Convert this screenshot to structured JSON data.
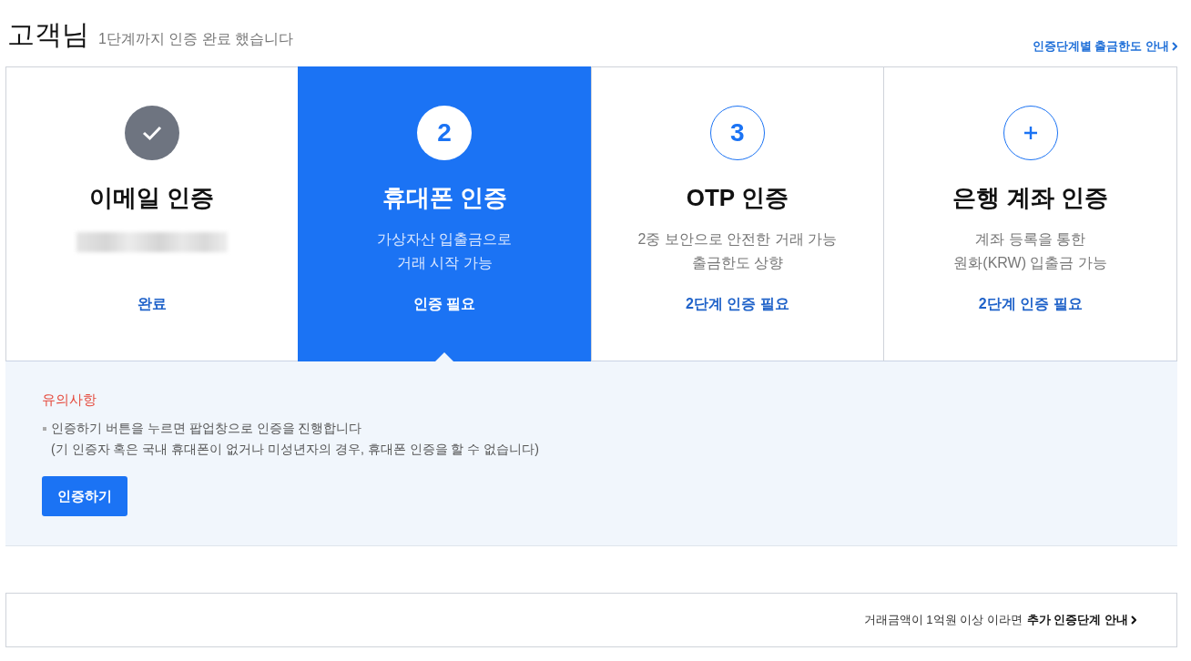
{
  "header": {
    "title": "고객님",
    "subtitle": "1단계까지 인증 완료 했습니다",
    "link": "인증단계별 출금한도 안내"
  },
  "steps": [
    {
      "kind": "done",
      "title": "이메일 인증",
      "redacted": true,
      "status": "완료",
      "selected": false
    },
    {
      "kind": "number",
      "badge": "2",
      "title": "휴대폰 인증",
      "description": [
        "가상자산 입출금으로",
        "거래 시작 가능"
      ],
      "status": "인증 필요",
      "selected": true
    },
    {
      "kind": "number",
      "badge": "3",
      "title": "OTP 인증",
      "description": [
        "2중 보안으로 안전한 거래 가능",
        "출금한도 상향"
      ],
      "status": "2단계 인증 필요",
      "selected": false
    },
    {
      "kind": "add",
      "title": "은행 계좌 인증",
      "description": [
        "계좌 등록을 통한",
        "원화(KRW) 입출금 가능"
      ],
      "status": "2단계 인증 필요",
      "selected": false
    }
  ],
  "notice": {
    "title": "유의사항",
    "items": [
      {
        "text": "인증하기 버튼을 누르면 팝업창으로 인증을 진행합니다",
        "note": "(기 인증자 혹은 국내 휴대폰이 없거나 미성년자의 경우, 휴대폰 인증을 할 수 없습니다)"
      }
    ],
    "button": "인증하기"
  },
  "footer": {
    "text": "거래금액이 1억원 이상 이라면",
    "link": "추가 인증단계 안내"
  }
}
